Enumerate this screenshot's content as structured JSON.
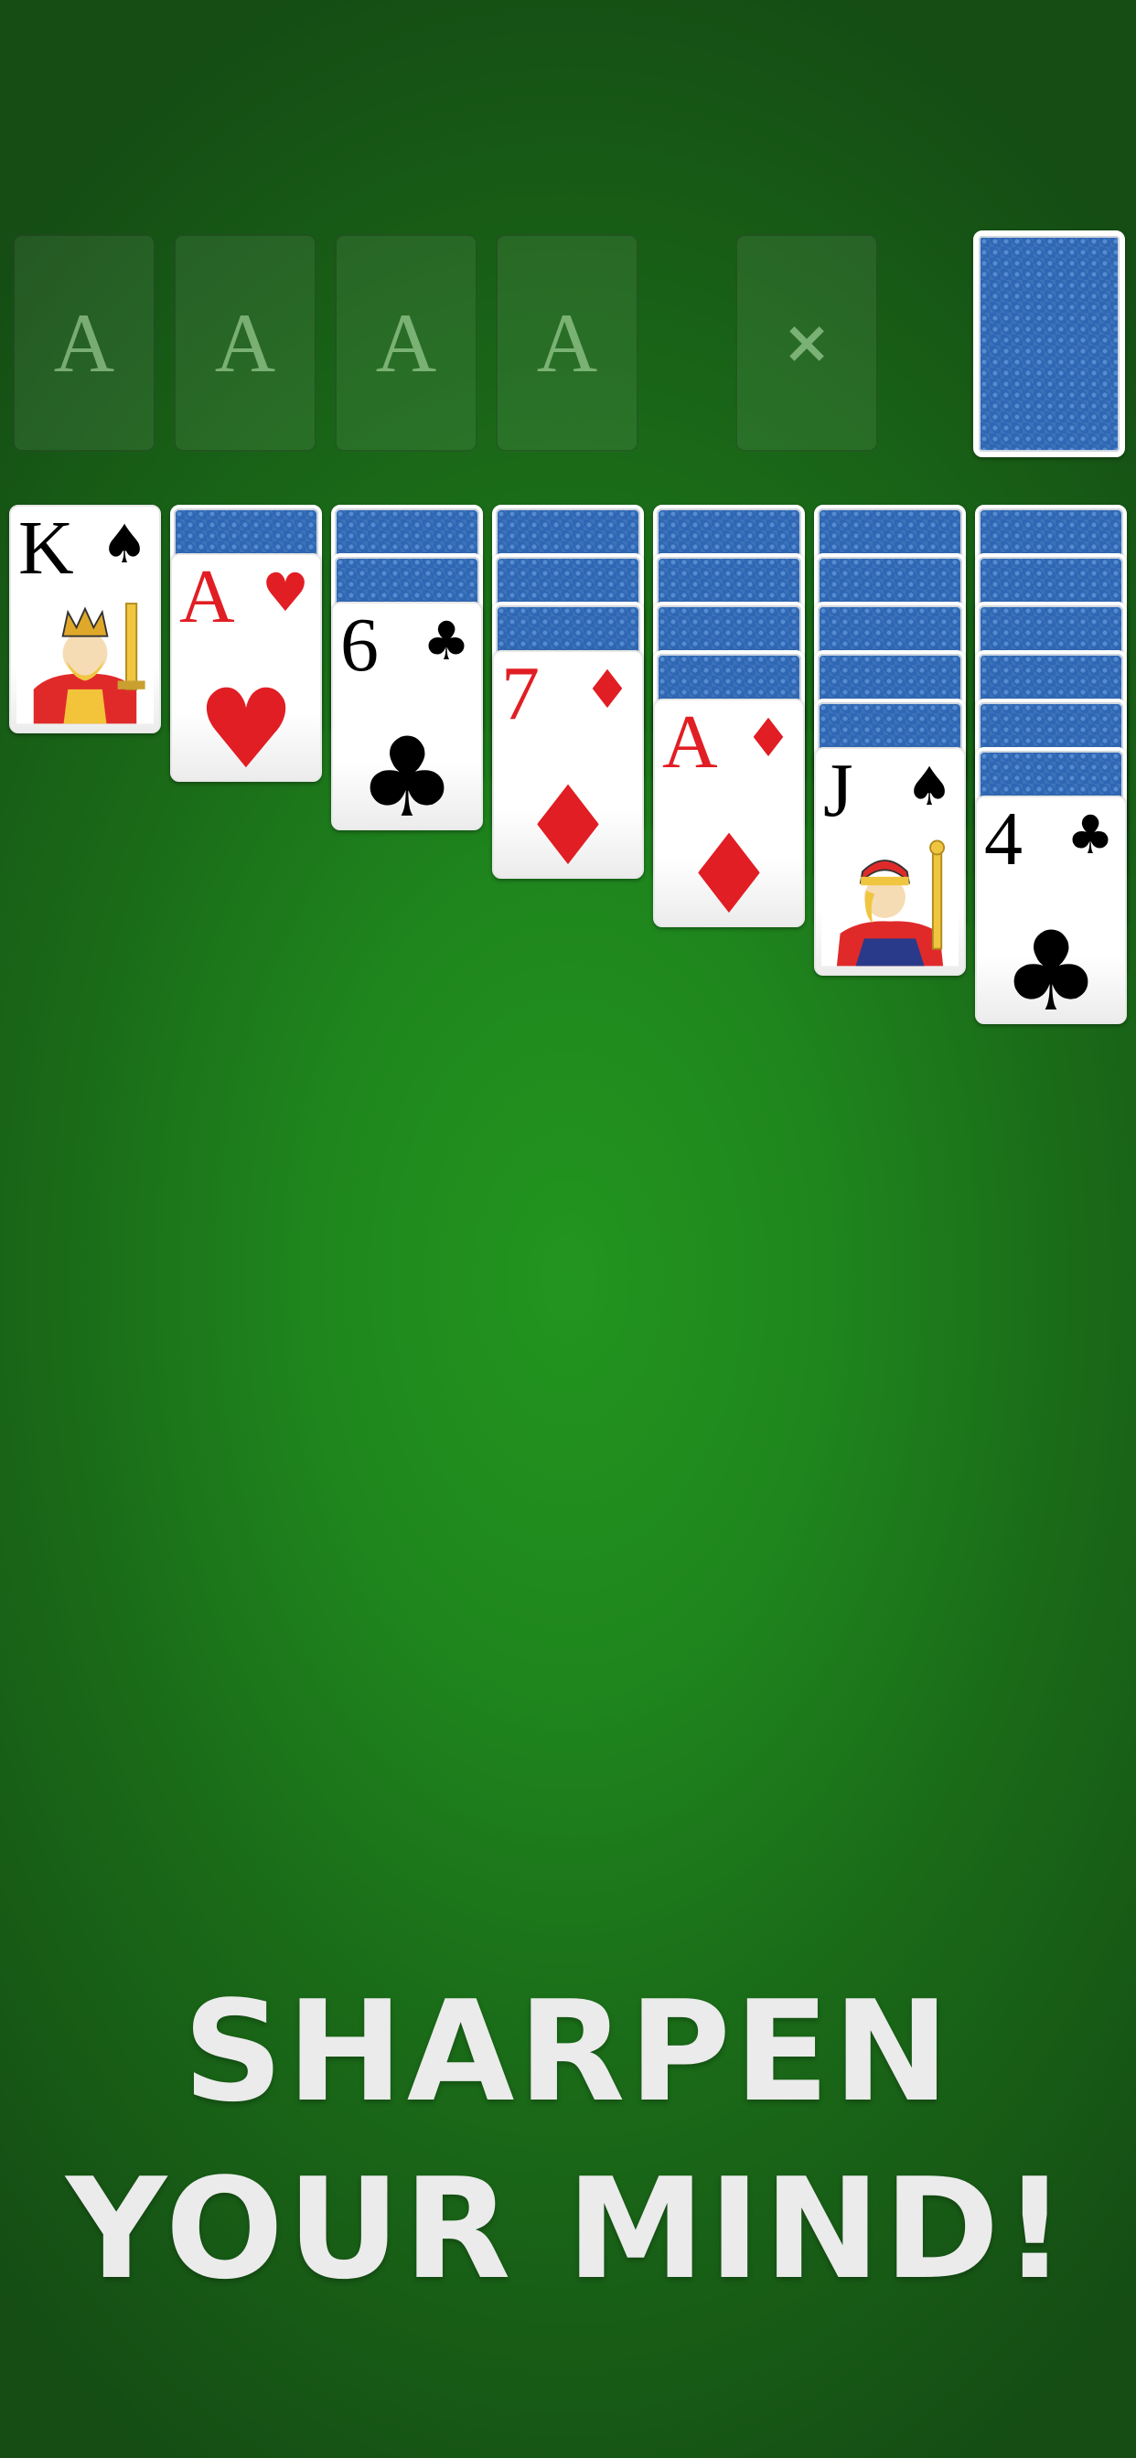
{
  "foundations": [
    {
      "label": "A"
    },
    {
      "label": "A"
    },
    {
      "label": "A"
    },
    {
      "label": "A"
    }
  ],
  "waste": {
    "icon": "close-icon",
    "symbol": "×"
  },
  "stock": {
    "state": "face-down"
  },
  "tableau": [
    {
      "face_down": 0,
      "face_up": {
        "rank": "K",
        "suit": "♠",
        "color": "black",
        "court": "king"
      }
    },
    {
      "face_down": 1,
      "face_up": {
        "rank": "A",
        "suit": "♥",
        "color": "red"
      }
    },
    {
      "face_down": 2,
      "face_up": {
        "rank": "6",
        "suit": "♣",
        "color": "black"
      }
    },
    {
      "face_down": 3,
      "face_up": {
        "rank": "7",
        "suit": "♦",
        "color": "red"
      }
    },
    {
      "face_down": 4,
      "face_up": {
        "rank": "A",
        "suit": "♦",
        "color": "red"
      }
    },
    {
      "face_down": 5,
      "face_up": {
        "rank": "J",
        "suit": "♠",
        "color": "black",
        "court": "jack"
      }
    },
    {
      "face_down": 6,
      "face_up": {
        "rank": "4",
        "suit": "♣",
        "color": "black"
      }
    }
  ],
  "headline": {
    "line1": "SHARPEN",
    "line2": "YOUR MIND!"
  },
  "colors": {
    "felt": "#1f861d",
    "card_back": "#2e67b4",
    "red_suit": "#e01e24",
    "headline": "#ebebeb"
  }
}
